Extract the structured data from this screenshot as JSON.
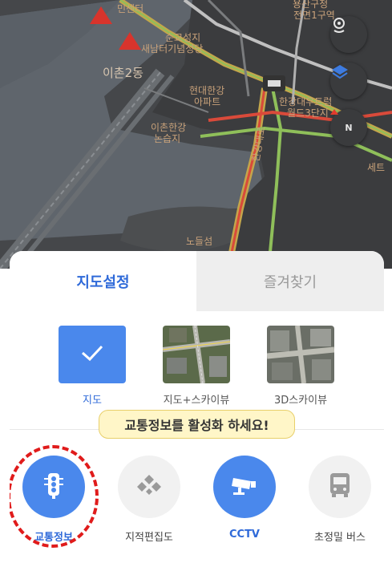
{
  "map": {
    "labels": {
      "top_right_1": "용산구청",
      "top_right_2": "전면1구역",
      "minsenter": "민센터",
      "cathedral_1": "순교성지",
      "cathedral_2": "새남터기념성당",
      "ichon2dong": "이촌2동",
      "hyundai_1": "현대한강",
      "hyundai_2": "아파트",
      "ichon_park_1": "이촌한강",
      "ichon_park_2": "논습지",
      "daewoo_1": "한강대우트럼",
      "daewoo_2": "월드3단지",
      "sette": "세트",
      "roadname": "한강대로",
      "nodeulseom": "노들섬"
    },
    "buttons": {
      "location": "location-pin-icon",
      "layers": "layers-icon",
      "compass": "N"
    }
  },
  "sheet": {
    "tabs": [
      {
        "label": "지도설정",
        "active": true
      },
      {
        "label": "즐겨찾기",
        "active": false
      }
    ],
    "map_types": [
      {
        "label": "지도",
        "selected": true
      },
      {
        "label": "지도+스카이뷰",
        "selected": false
      },
      {
        "label": "3D스카이뷰",
        "selected": false
      }
    ],
    "tooltip": "교통정보를 활성화 하세요!",
    "layers": [
      {
        "label": "교통정보",
        "active": true,
        "icon": "traffic-light-icon"
      },
      {
        "label": "지적편집도",
        "active": false,
        "icon": "cadastral-icon"
      },
      {
        "label": "CCTV",
        "active": true,
        "icon": "cctv-camera-icon"
      },
      {
        "label": "초정밀 버스",
        "active": false,
        "icon": "bus-icon"
      }
    ]
  },
  "colors": {
    "accent": "#2f6ad9",
    "layer_on": "#4a88ec",
    "tooltip_bg": "#fff6c8",
    "highlight": "#e01b1b"
  }
}
